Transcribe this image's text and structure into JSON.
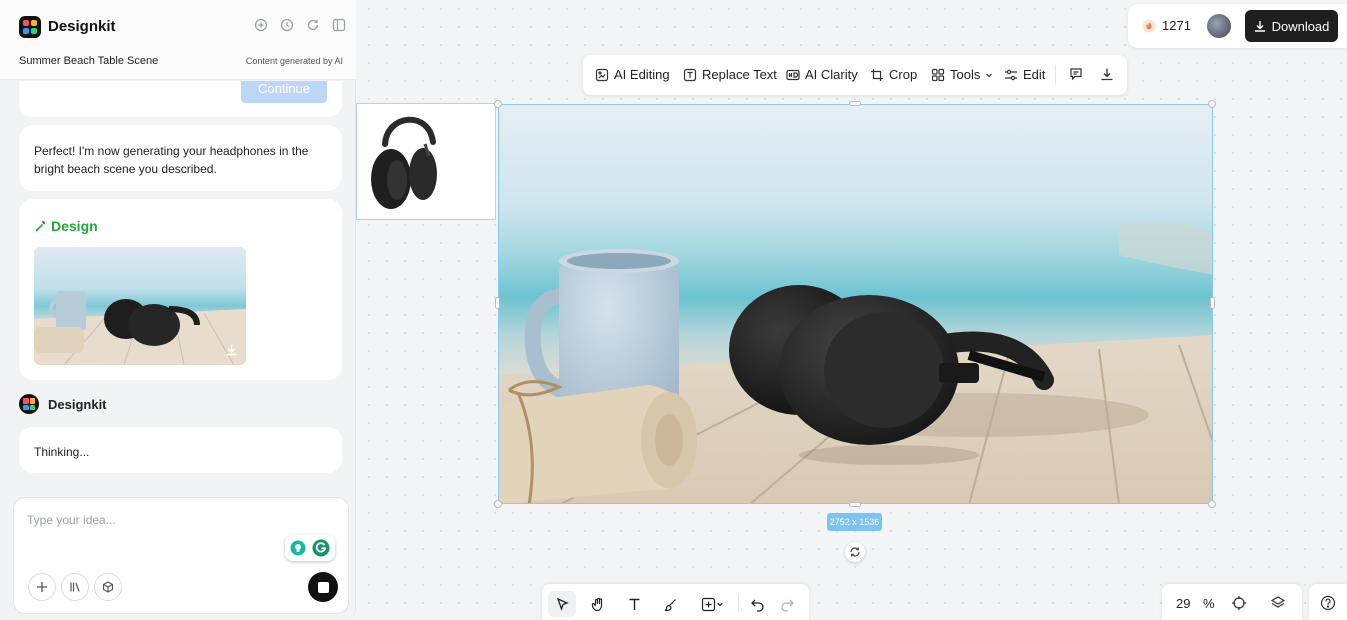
{
  "app": {
    "name": "Designkit"
  },
  "header": {
    "project_title": "Summer Beach Table Scene",
    "ai_note": "Content generated by AI",
    "icons": [
      "add-chat-icon",
      "history-icon",
      "refresh-icon",
      "panel-toggle-icon"
    ]
  },
  "chat": {
    "continue_label": "Continue",
    "message": "Perfect! I'm now generating your headphones in the bright beach scene you described.",
    "design_label": "Design",
    "bot_name": "Designkit",
    "thinking": "Thinking..."
  },
  "composer": {
    "placeholder": "Type your idea...",
    "tool_icons": [
      "plus-icon",
      "library-icon",
      "box-icon"
    ],
    "stop_icon": "stop-icon"
  },
  "account": {
    "credits": "1271",
    "download_label": "Download"
  },
  "toolbar": {
    "ai_editing": "AI Editing",
    "replace_text": "Replace Text",
    "ai_clarity": "AI Clarity",
    "crop": "Crop",
    "tools": "Tools",
    "edit": "Edit"
  },
  "canvas": {
    "dimensions": "2752 x 1536"
  },
  "bottom_tools": [
    "select-icon",
    "hand-icon",
    "text-icon",
    "brush-icon",
    "add-shape-icon",
    "undo-icon",
    "redo-icon"
  ],
  "zoom": {
    "value": "29",
    "unit": "%"
  },
  "colors": {
    "accent_green": "#22a838",
    "selection_blue": "#8cc8f5",
    "continue_button": "#bcd6f7",
    "download_button": "#1f1f1f"
  }
}
